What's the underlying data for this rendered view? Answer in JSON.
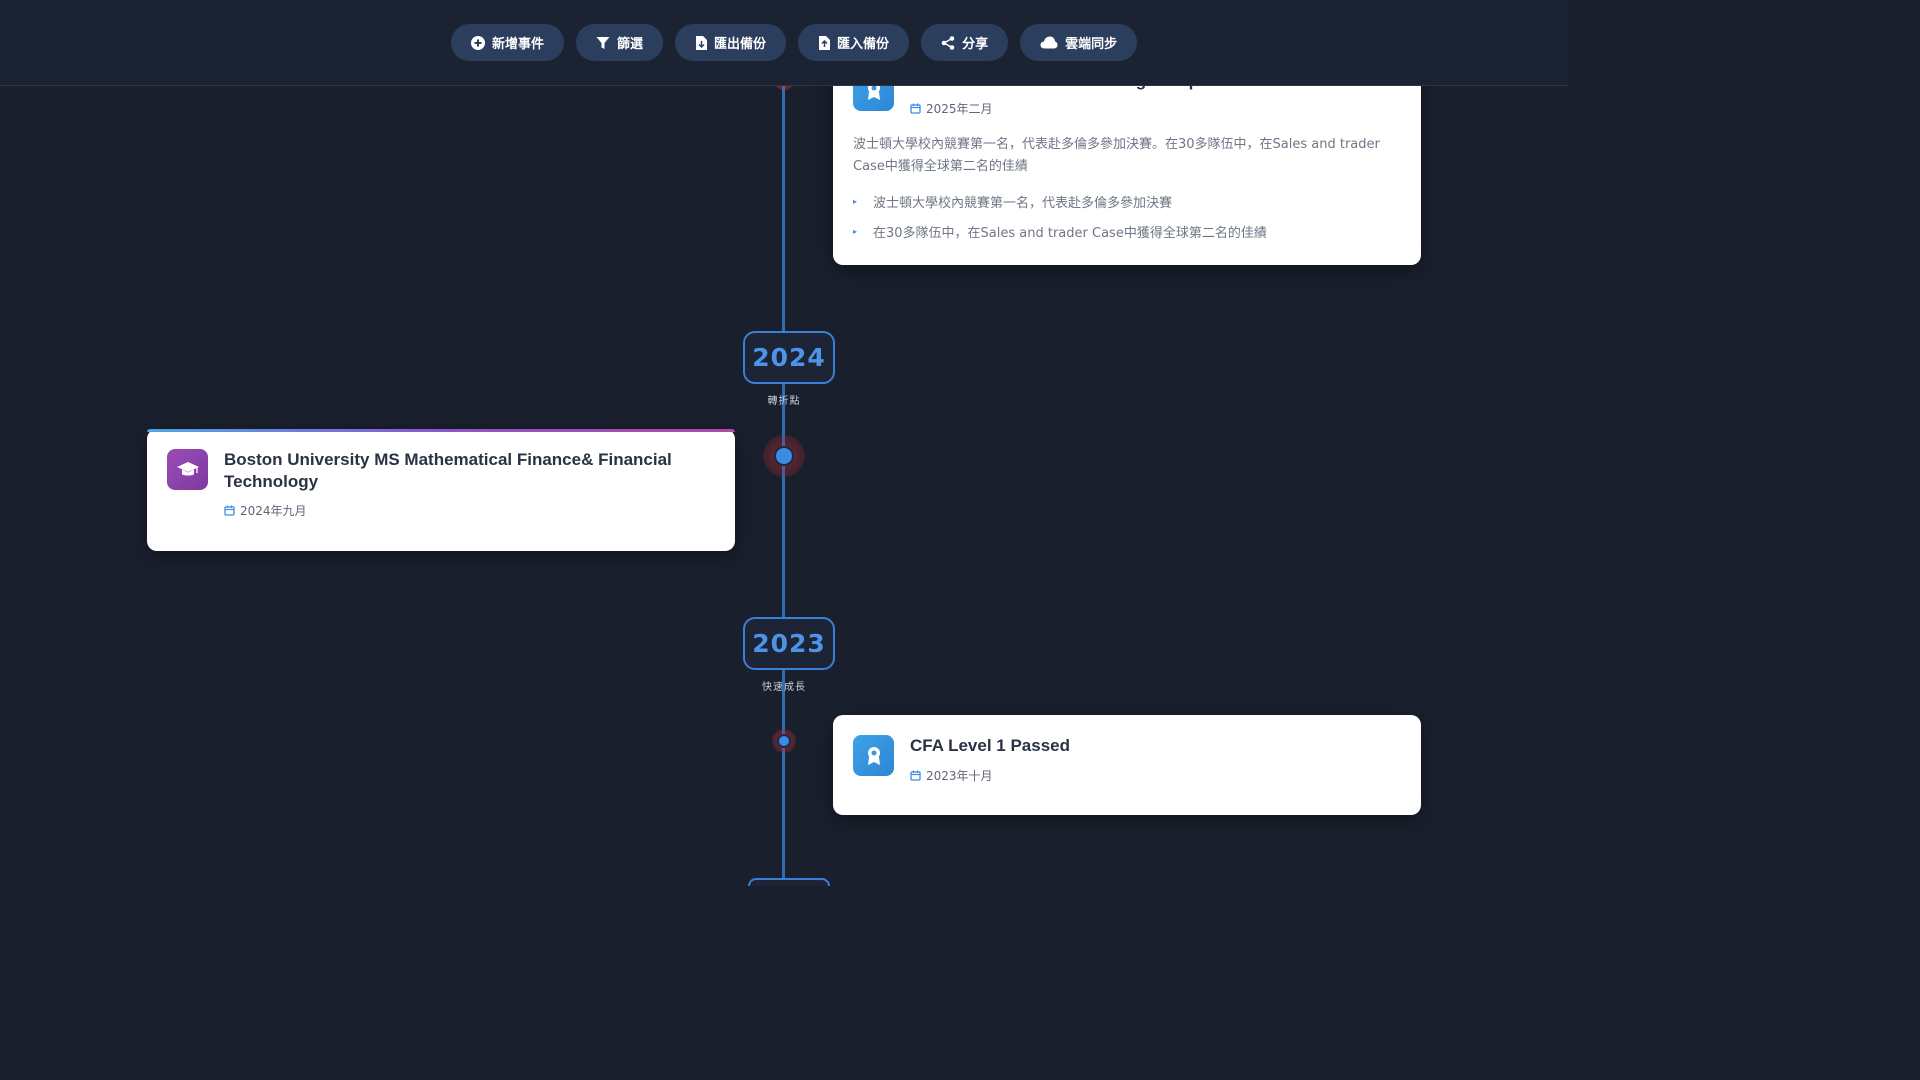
{
  "toolbar": {
    "buttons": [
      {
        "label": "新增事件",
        "icon": "plus-circle-icon"
      },
      {
        "label": "篩選",
        "icon": "filter-icon"
      },
      {
        "label": "匯出備份",
        "icon": "file-export-icon"
      },
      {
        "label": "匯入備份",
        "icon": "file-import-icon"
      },
      {
        "label": "分享",
        "icon": "share-icon"
      },
      {
        "label": "雲端同步",
        "icon": "cloud-icon"
      }
    ]
  },
  "timeline": {
    "years": [
      {
        "year": "2024",
        "subtitle": "轉折點"
      },
      {
        "year": "2023",
        "subtitle": "快速成長"
      }
    ],
    "events": [
      {
        "title": "Rotman International Trading Competition",
        "date": "2025年二月",
        "icon": "award-icon",
        "description": "波士頓大學校內競賽第一名，代表赴多倫多參加決賽。在30多隊伍中，在Sales and trader Case中獲得全球第二名的佳績",
        "bullets": [
          "波士頓大學校內競賽第一名，代表赴多倫多參加決賽",
          "在30多隊伍中，在Sales and trader Case中獲得全球第二名的佳績"
        ]
      },
      {
        "title": "Boston University MS Mathematical Finance& Financial Technology",
        "date": "2024年九月",
        "icon": "graduation-cap-icon"
      },
      {
        "title": "CFA Level 1 Passed",
        "date": "2023年十月",
        "icon": "award-icon"
      }
    ]
  },
  "colors": {
    "background": "#1a1f2e",
    "timeline_line": "#2f6db5",
    "accent_blue": "#3d8be6",
    "accent_purple": "#8e44ad",
    "button_bg": "#2c3e5e"
  }
}
